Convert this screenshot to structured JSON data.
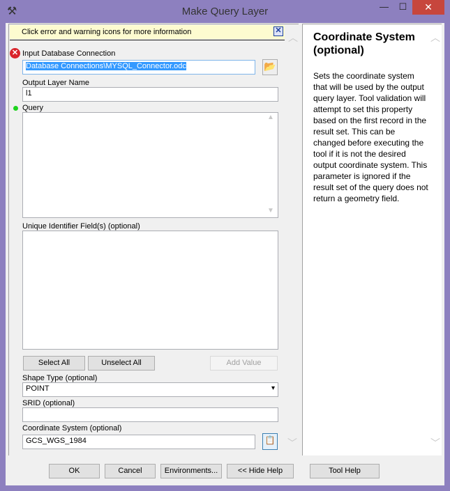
{
  "window": {
    "title": "Make Query Layer",
    "minimize": "—",
    "maximize": "☐",
    "close": "✕"
  },
  "infobar": {
    "text": "Click error and warning icons for more information",
    "close": "✕"
  },
  "params": {
    "db_conn_label": "Input Database Connection",
    "db_conn_value": "Database Connections\\MYSQL_Connector.odc",
    "out_label": "Output Layer Name",
    "out_value": "l1",
    "query_label": "Query",
    "uid_label": "Unique Identifier Field(s) (optional)",
    "select_all": "Select All",
    "unselect_all": "Unselect All",
    "add_value": "Add Value",
    "shape_label": "Shape Type (optional)",
    "shape_value": "POINT",
    "srid_label": "SRID (optional)",
    "srid_value": "",
    "cs_label": "Coordinate System (optional)",
    "cs_value": "GCS_WGS_1984"
  },
  "help": {
    "title": "Coordinate System (optional)",
    "text": "Sets the coordinate system that will be used by the output query layer. Tool validation will attempt to set this property based on the first record in the result set. This can be changed before executing the tool if it is not the desired output coordinate system. This parameter is ignored if the result set of the query does not return a geometry field."
  },
  "buttons": {
    "ok": "OK",
    "cancel": "Cancel",
    "environments": "Environments...",
    "hide_help": "<< Hide Help",
    "tool_help": "Tool Help"
  },
  "colors": {
    "titlebar": "#8d80bf",
    "close": "#c7463d",
    "error": "#d9242b",
    "ok_dot": "#1ed31e"
  }
}
